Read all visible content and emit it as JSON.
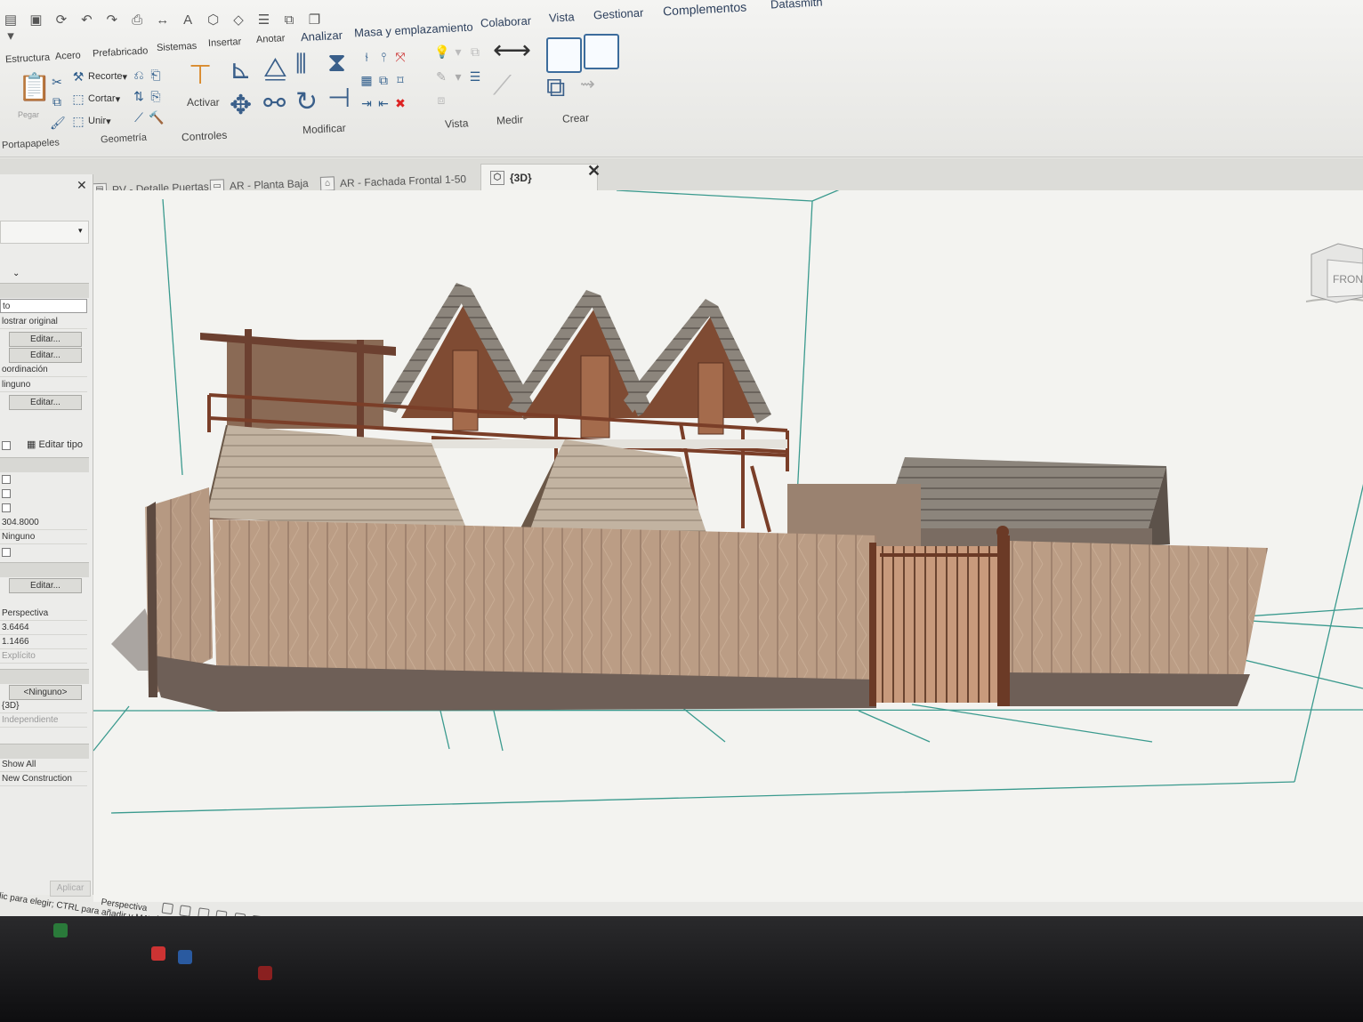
{
  "ribbon": {
    "tabs": [
      "Estructura",
      "Acero",
      "Prefabricado",
      "Sistemas",
      "Insertar",
      "Anotar",
      "Analizar",
      "Masa y emplazamiento",
      "Colaborar",
      "Vista",
      "Gestionar",
      "Complementos",
      "Datasmith"
    ],
    "panels": {
      "clipboard": {
        "label": "Portapapeles",
        "paste": "Pegar"
      },
      "geometry": {
        "label": "Geometría",
        "cope": "Recorte",
        "cut": "Cortar",
        "join": "Unir"
      },
      "controls": {
        "label": "Controles",
        "activate": "Activar"
      },
      "modify": {
        "label": "Modificar"
      },
      "view": {
        "label": "Vista"
      },
      "measure": {
        "label": "Medir"
      },
      "create": {
        "label": "Crear"
      }
    }
  },
  "view_tabs": [
    {
      "label": "PV - Detalle Puertas",
      "icon": "sheet-icon"
    },
    {
      "label": "AR - Planta Baja",
      "icon": "plan-icon"
    },
    {
      "label": "AR - Fachada Frontal 1-50",
      "icon": "elevation-icon"
    },
    {
      "label": "{3D}",
      "icon": "3d-view-icon",
      "active": true
    }
  ],
  "properties": {
    "edit_type": "Editar tipo",
    "rows": [
      {
        "text": "to"
      },
      {
        "text": "lostrar original"
      },
      {
        "button": "Editar..."
      },
      {
        "button": "Editar..."
      },
      {
        "text": "oordinación"
      },
      {
        "text": "linguno"
      },
      {
        "button": "Editar..."
      }
    ],
    "rows2": [
      {
        "text": "304.8000"
      },
      {
        "text": "Ninguno"
      },
      {
        "button": "Editar..."
      },
      {
        "text": "Perspectiva"
      },
      {
        "text": "3.6464"
      },
      {
        "text": "1.1466"
      },
      {
        "text": "Explícito"
      },
      {
        "button": "<Ninguno>"
      },
      {
        "text": "{3D}"
      },
      {
        "text": "Independiente"
      },
      {
        "text": "Show All"
      },
      {
        "text": "New Construction"
      }
    ],
    "apply": "Aplicar"
  },
  "viewcube": {
    "face": "FRONT"
  },
  "view_control_bar": {
    "label": "Perspectiva"
  },
  "status_bar": {
    "text": "lic para elegir; CTRL para añadir y MAYÚS para anular una selección."
  },
  "colors": {
    "ribbon_text": "#2c3f5c",
    "canvas_bg": "#f3f3f0",
    "wood_wall": "#b89a82",
    "roof": "#8a8278",
    "section_box": "#2e8b8b"
  }
}
